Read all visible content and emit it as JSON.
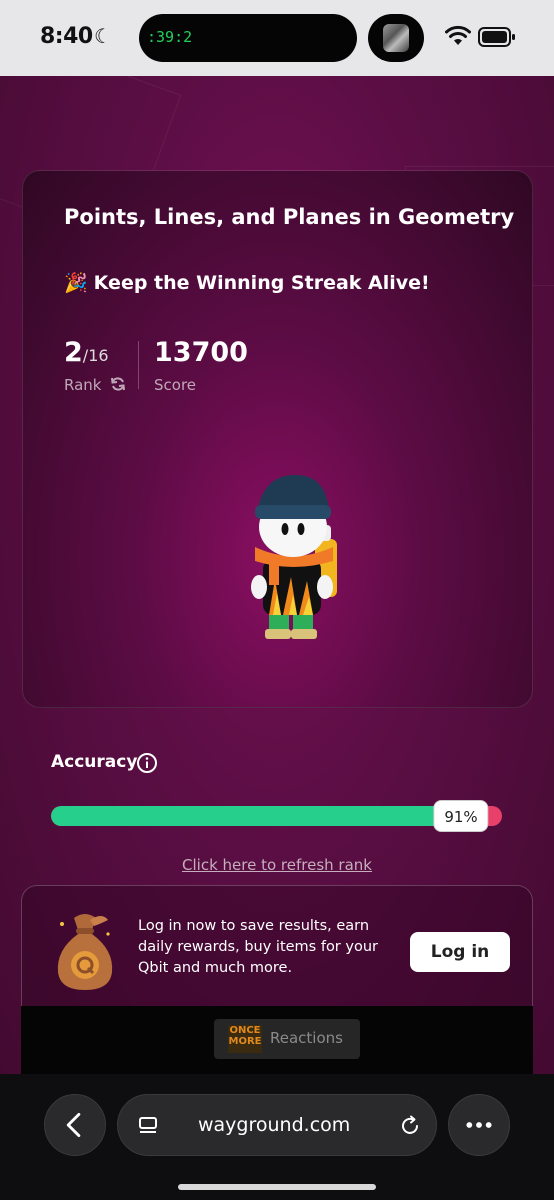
{
  "status_bar": {
    "time": "8:40",
    "island_timer": ":39:2",
    "icons": [
      "moon-icon",
      "wifi-icon",
      "battery-icon"
    ]
  },
  "quiz": {
    "title": "Points, Lines, and Planes in Geometry",
    "streak_icon": "🎉",
    "streak_text": "Keep the Winning Streak Alive!",
    "rank": "2",
    "rank_total": "/16",
    "rank_label": "Rank",
    "score": "13700",
    "score_label": "Score"
  },
  "accuracy": {
    "label": "Accuracy",
    "percent": 91,
    "percent_text": "91%",
    "refresh_link": "Click here to refresh rank",
    "colors": {
      "correct": "#27cf8c",
      "incorrect": "#e83f6b"
    }
  },
  "login_promo": {
    "text": "Log in now to save results, earn daily rewards, buy items for your Qbit and much more.",
    "button": "Log in"
  },
  "reactions": {
    "logo_text": "ONCE MORE",
    "label": "Reactions"
  },
  "browser": {
    "url": "wayground.com"
  }
}
